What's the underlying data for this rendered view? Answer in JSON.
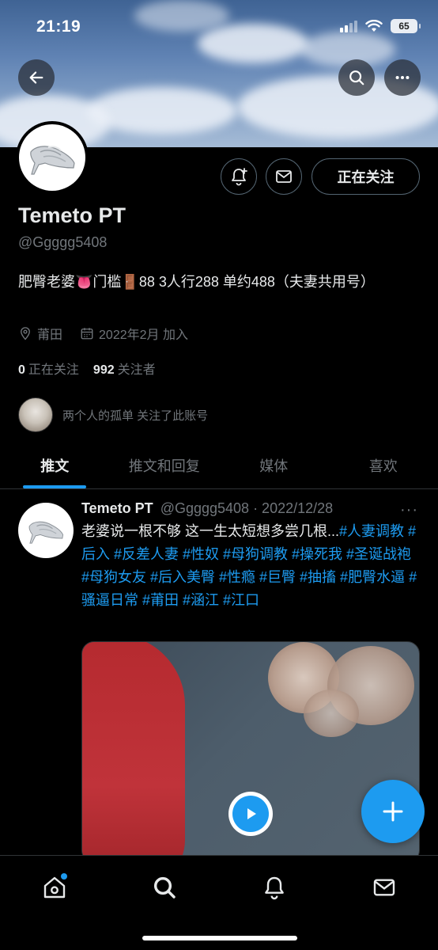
{
  "status_bar": {
    "time": "21:19",
    "battery": "65"
  },
  "profile": {
    "display_name": "Temeto PT",
    "handle": "@Ggggg5408",
    "bio": "肥臀老婆👅门槛🚪88 3人行288 单约488（夫妻共用号）",
    "location": "莆田",
    "joined": "2022年2月 加入",
    "following_count": "0",
    "following_label": "正在关注",
    "followers_count": "992",
    "followers_label": "关注者",
    "follow_button": "正在关注",
    "followed_by": "两个人的孤单 关注了此账号"
  },
  "tabs": [
    {
      "label": "推文",
      "active": true
    },
    {
      "label": "推文和回复",
      "active": false
    },
    {
      "label": "媒体",
      "active": false
    },
    {
      "label": "喜欢",
      "active": false
    }
  ],
  "tweet": {
    "name": "Temeto PT",
    "handle_date": "@Ggggg5408 · 2022/12/28",
    "more": "···",
    "text_plain": "老婆说一根不够 这一生太短想多尝几根...",
    "hashtags": "#人妻调教 #后入 #反差人妻 #性奴 #母狗调教 #操死我 #圣诞战袍 #母狗女友 #后入美臀 #性瘾 #巨臀 #抽搐 #肥臀水逼 #骚逼日常 #莆田 #涵江 #江口"
  },
  "colors": {
    "accent": "#1d9bf0",
    "muted": "#71767b",
    "text": "#e7e9ea",
    "border": "#2f3336"
  },
  "icons": {
    "back": "arrow-left-icon",
    "search": "search-icon",
    "more": "more-horizontal-icon",
    "notify": "bell-plus-icon",
    "message": "envelope-icon",
    "location": "map-pin-icon",
    "calendar": "calendar-icon",
    "fab": "plus-icon",
    "play": "play-icon",
    "nav_home": "home-icon",
    "nav_search": "search-icon",
    "nav_notifications": "bell-icon",
    "nav_messages": "envelope-icon"
  }
}
